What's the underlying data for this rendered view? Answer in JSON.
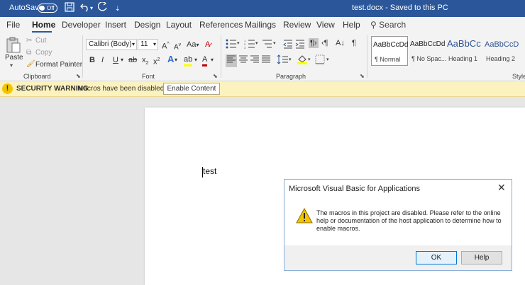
{
  "titlebar": {
    "autosave_label": "AutoSave",
    "autosave_state": "Off",
    "save_icon": "save-icon",
    "undo_icon": "undo-icon",
    "redo_icon": "redo-icon",
    "customize_icon": "customize-icon",
    "document_title": "test.docx  -  Saved to this PC"
  },
  "tabs": {
    "items": [
      "File",
      "Home",
      "Developer",
      "Insert",
      "Design",
      "Layout",
      "References",
      "Mailings",
      "Review",
      "View",
      "Help"
    ],
    "active": "Home",
    "search_label": "Search"
  },
  "ribbon": {
    "clipboard": {
      "paste_label": "Paste",
      "cut_label": "Cut",
      "copy_label": "Copy",
      "format_painter_label": "Format Painter",
      "group_label": "Clipboard"
    },
    "font": {
      "font_name": "Calibri (Body)",
      "font_size": "11",
      "group_label": "Font",
      "bold": "B",
      "italic": "I",
      "underline": "U",
      "strike": "ab",
      "subscript": "x",
      "superscript": "x",
      "grow": "A",
      "shrink": "A",
      "change_case": "Aa",
      "text_effects": "A",
      "highlight": "ab",
      "font_color": "A"
    },
    "paragraph": {
      "group_label": "Paragraph"
    },
    "styles": {
      "items": [
        {
          "sample": "AaBbCcDd",
          "name": "¶ Normal"
        },
        {
          "sample": "AaBbCcDd",
          "name": "¶ No Spac..."
        },
        {
          "sample": "AaBbCc",
          "name": "Heading 1"
        },
        {
          "sample": "AaBbCcD",
          "name": "Heading 2"
        }
      ],
      "group_label": "Styles"
    }
  },
  "security_bar": {
    "title": "SECURITY WARNING",
    "message": "Macros have been disabled.",
    "button_label": "Enable Content"
  },
  "document": {
    "text": "test"
  },
  "dialog": {
    "title": "Microsoft Visual Basic for Applications",
    "message": "The macros in this project are disabled.  Please refer to the online help or documentation of the host application to determine how to enable macros.",
    "ok_label": "OK",
    "help_label": "Help"
  },
  "colors": {
    "titlebar": "#2b579a",
    "security_bar": "#fcf2bd"
  }
}
